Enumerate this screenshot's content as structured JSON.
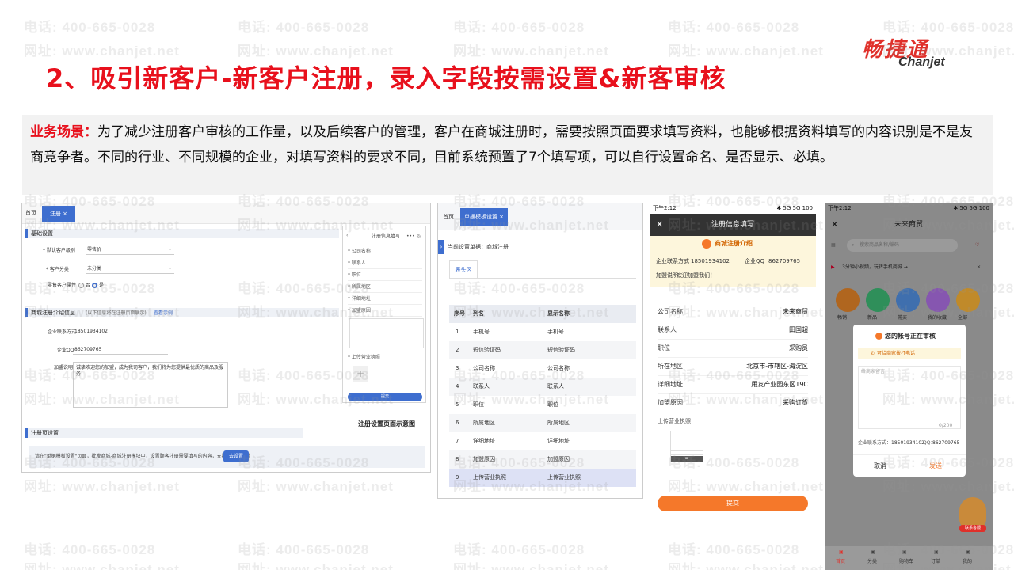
{
  "brand": {
    "cn": "畅捷通",
    "en": "Chanjet"
  },
  "watermark": {
    "phone": "电话: 400-665-0028",
    "site": "网址: www.chanjet.net"
  },
  "title": "2、吸引新客户-新客户注册，录入字段按需设置&新客审核",
  "desc": {
    "lead": "业务场景：",
    "text": "为了减少注册客户审核的工作量，以及后续客户的管理，客户在商城注册时，需要按照页面要求填写资料，也能够根据资料填写的内容识别是不是友商竞争者。不同的行业、不同规模的企业，对填写资料的要求不同，目前系统预置了7个填写项，可以自行设置命名、是否显示、必填。"
  },
  "s1": {
    "tab_home": "首页",
    "tab_active": "注册 ×",
    "sec_basic": "基础设置",
    "lbl_level": "* 默认客户级别",
    "val_level": "零售价",
    "lbl_cat": "* 客户分类",
    "val_cat": "未分类",
    "lbl_attr": "零售客户属性",
    "opt_no": "否",
    "opt_yes": "是",
    "sec_intro": "商城注册介绍信息",
    "intro_tip": "(以下信息将在注册页面展示)",
    "intro_link": "查看示例",
    "lbl_phone": "企业联系方式",
    "val_phone": "18501934102",
    "lbl_qq": "企业QQ",
    "val_qq": "862709765",
    "lbl_note": "加盟说明",
    "val_note": "诚挚欢迎您的加盟，成为我司客户，我们将为您提供最优质的商品及服务！",
    "sec_reg": "注册页设置",
    "reg_tip": "请在\"单据模板设置\"页面，批发商城-商城注册模块中，设置顾客注册需要填写的内容，支持自定义字段",
    "reg_btn": "去设置",
    "preview_caption": "注册设置页面示意图",
    "phone_title": "注册信息填写",
    "phone_fields": [
      "* 公司名称",
      "* 联系人",
      "* 职位",
      "* 所属地区",
      "* 详细地址",
      "* 加盟原因",
      "* 上传营业执照"
    ],
    "phone_submit": "提交"
  },
  "s2": {
    "tab_home": "首页",
    "tab_active": "单据模板设置 ×",
    "current": "当前设置单据：商城注册",
    "subtab": "表头区",
    "col_no": "序号",
    "col_name": "列名",
    "col_display": "显示名称",
    "rows": [
      {
        "no": "1",
        "name": "手机号",
        "disp": "手机号"
      },
      {
        "no": "2",
        "name": "短信验证码",
        "disp": "短信验证码"
      },
      {
        "no": "3",
        "name": "公司名称",
        "disp": "公司名称"
      },
      {
        "no": "4",
        "name": "联系人",
        "disp": "联系人"
      },
      {
        "no": "5",
        "name": "职位",
        "disp": "职位"
      },
      {
        "no": "6",
        "name": "所属地区",
        "disp": "所属地区"
      },
      {
        "no": "7",
        "name": "详细地址",
        "disp": "详细地址"
      },
      {
        "no": "8",
        "name": "加盟原因",
        "disp": "加盟原因"
      },
      {
        "no": "9",
        "name": "上传营业执照",
        "disp": "上传营业执照"
      }
    ]
  },
  "s3": {
    "time": "下午2:12",
    "status_right": "✱ 5G 5G 100",
    "title": "注册信息填写",
    "banner": "商城注册介绍",
    "lbl_phone": "企业联系方式",
    "val_phone": "18501934102",
    "lbl_qq": "企业QQ",
    "val_qq": "862709765",
    "lbl_note": "加盟说明",
    "val_note": "欢迎加盟我们！",
    "rows": [
      {
        "label": "公司名称",
        "value": "未来商贸"
      },
      {
        "label": "联系人",
        "value": "田国超"
      },
      {
        "label": "职位",
        "value": "采购员"
      },
      {
        "label": "所在地区",
        "value": "北京市-市辖区-海淀区"
      },
      {
        "label": "详细地址",
        "value": "用友产业园东区19C"
      },
      {
        "label": "加盟原因",
        "value": "采购订货"
      }
    ],
    "upload": "上传营业执照",
    "submit": "提交"
  },
  "s4": {
    "time": "下午2:12",
    "status_right": "✱ 5G 5G 100",
    "title": "未来商贸",
    "search_placeholder": "搜索商品名称/编码",
    "promo": "3分钟小视频，玩转手机商城 →",
    "icons": [
      "畅销",
      "新品",
      "常买",
      "我的收藏",
      "全部"
    ],
    "modal_title": "您的帐号正在审核",
    "modal_call": "可给商家拨打电话",
    "modal_placeholder": "给商家留言",
    "modal_counter": "0/200",
    "modal_phone_lbl": "企业联系方式：",
    "modal_phone": "18501934102",
    "modal_qq_lbl": "QQ：",
    "modal_qq": "862709765",
    "btn_cancel": "取消",
    "btn_send": "发送",
    "badge": "联系客服",
    "tabs": [
      "首页",
      "分类",
      "购物车",
      "订单",
      "我的"
    ]
  },
  "colors": {
    "red": "#e8101c",
    "blue": "#3e6ecf",
    "orange": "#f5782a",
    "cream": "#fdf6dc"
  }
}
